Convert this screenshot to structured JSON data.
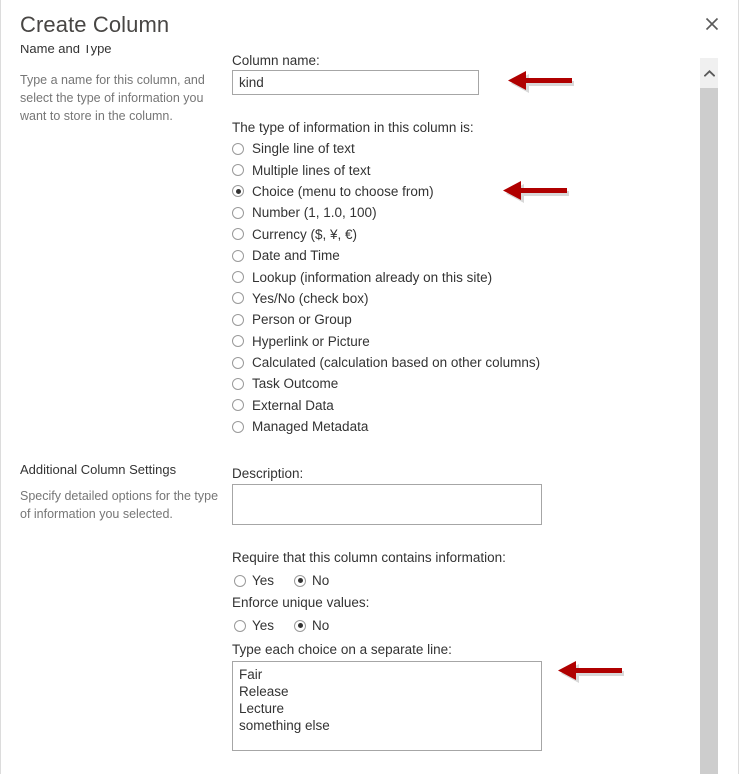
{
  "dialog": {
    "title": "Create Column",
    "close_label": "Close"
  },
  "sections": {
    "name_and_type": {
      "heading": "Name and Type",
      "description": "Type a name for this column, and select the type of information you want to store in the column."
    },
    "additional_settings": {
      "heading": "Additional Column Settings",
      "description": "Specify detailed options for the type of information you selected."
    }
  },
  "fields": {
    "column_name": {
      "label": "Column name:",
      "value": "kind",
      "placeholder": ""
    },
    "type_prompt": "The type of information in this column is:",
    "type_options": [
      {
        "label": "Single line of text",
        "checked": false
      },
      {
        "label": "Multiple lines of text",
        "checked": false
      },
      {
        "label": "Choice (menu to choose from)",
        "checked": true
      },
      {
        "label": "Number (1, 1.0, 100)",
        "checked": false
      },
      {
        "label": "Currency ($, ¥, €)",
        "checked": false
      },
      {
        "label": "Date and Time",
        "checked": false
      },
      {
        "label": "Lookup (information already on this site)",
        "checked": false
      },
      {
        "label": "Yes/No (check box)",
        "checked": false
      },
      {
        "label": "Person or Group",
        "checked": false
      },
      {
        "label": "Hyperlink or Picture",
        "checked": false
      },
      {
        "label": "Calculated (calculation based on other columns)",
        "checked": false
      },
      {
        "label": "Task Outcome",
        "checked": false
      },
      {
        "label": "External Data",
        "checked": false
      },
      {
        "label": "Managed Metadata",
        "checked": false
      }
    ],
    "description": {
      "label": "Description:",
      "value": "",
      "placeholder": ""
    },
    "require_info": {
      "label": "Require that this column contains information:",
      "yes_label": "Yes",
      "no_label": "No",
      "selected": "No"
    },
    "enforce_unique": {
      "label": "Enforce unique values:",
      "yes_label": "Yes",
      "no_label": "No",
      "selected": "No"
    },
    "choices": {
      "label": "Type each choice on a separate line:",
      "value": "Fair\nRelease\nLecture\nsomething else",
      "placeholder": ""
    }
  },
  "scrollbar": {
    "up_arrow": "chevron-up"
  },
  "annotations": {
    "arrow_color": "#B00000",
    "arrows": [
      {
        "target": "column-name-input"
      },
      {
        "target": "choice-radio-option"
      },
      {
        "target": "choices-textarea"
      }
    ]
  }
}
